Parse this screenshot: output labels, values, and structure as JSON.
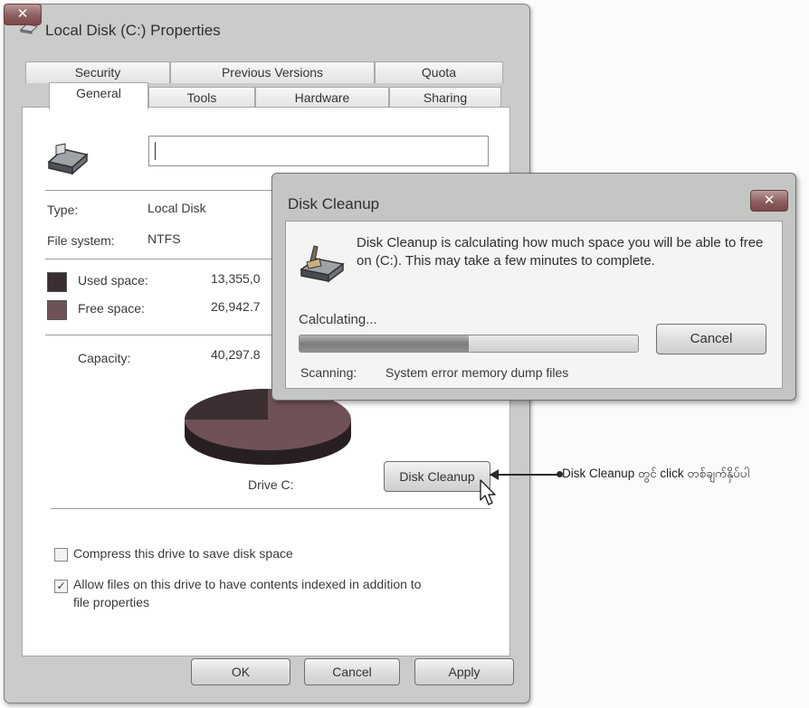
{
  "properties_window": {
    "title": "Local Disk (C:) Properties",
    "close_glyph": "✕",
    "tabs_row1": [
      "Security",
      "Previous Versions",
      "Quota"
    ],
    "tabs_row2": [
      "General",
      "Tools",
      "Hardware",
      "Sharing"
    ],
    "active_tab": "General",
    "drive_name_value": "",
    "type_label": "Type:",
    "type_value": "Local Disk",
    "fs_label": "File system:",
    "fs_value": "NTFS",
    "used_label": "Used space:",
    "used_value": "13,355,0",
    "free_label": "Free space:",
    "free_value": "26,942.7",
    "capacity_label": "Capacity:",
    "capacity_value": "40,297.8",
    "drive_caption": "Drive C:",
    "disk_cleanup_button": "Disk Cleanup",
    "compress_label": "Compress this drive to save disk space",
    "compress_checked": false,
    "index_label_line1": "Allow files on this drive to have contents indexed in addition to",
    "index_label_line2": "file properties",
    "index_checked": true,
    "check_glyph": "✓",
    "ok_button": "OK",
    "cancel_button": "Cancel",
    "apply_button": "Apply",
    "colors": {
      "used": "#3a2e30",
      "free": "#6f5257"
    },
    "icons": [
      "drive-icon",
      "close-icon",
      "pie-chart-icon",
      "cursor-icon"
    ]
  },
  "disk_cleanup_dialog": {
    "title": "Disk Cleanup",
    "close_glyph": "✕",
    "message": "Disk Cleanup is calculating how much space you will be able to free on  (C:). This may take a few minutes to complete.",
    "status": "Calculating...",
    "progress_fraction": 0.5,
    "cancel_button": "Cancel",
    "scanning_label": "Scanning:",
    "scanning_value": "System error memory dump files",
    "icons": [
      "cleanup-icon",
      "close-icon"
    ]
  },
  "annotation": {
    "text": "Disk Cleanup တွင် click တစ်ချက်နှိပ်ပါ"
  }
}
